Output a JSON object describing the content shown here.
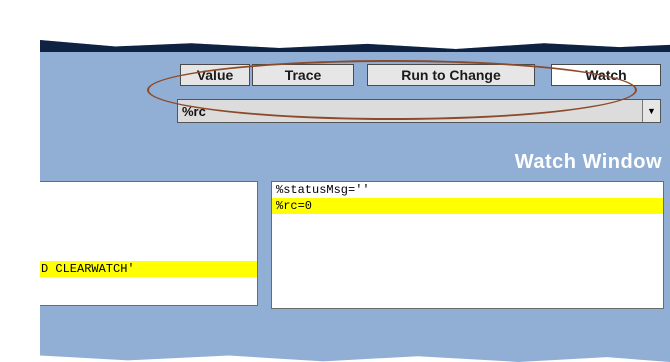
{
  "toolbar": {
    "value_label": "Value",
    "trace_label": "Trace",
    "run_to_change_label": "Run to Change",
    "watch_label": "Watch"
  },
  "watch_input": {
    "value": "%rc"
  },
  "watch_window": {
    "title": "Watch Window"
  },
  "left_panel": {
    "partial_line": "D CLEARWATCH'"
  },
  "right_panel": {
    "lines": [
      "%statusMsg=''",
      "%rc=0"
    ]
  },
  "colors": {
    "background": "#91afd4",
    "highlight": "#ffff00",
    "annotation_oval": "#8b4b2b"
  }
}
